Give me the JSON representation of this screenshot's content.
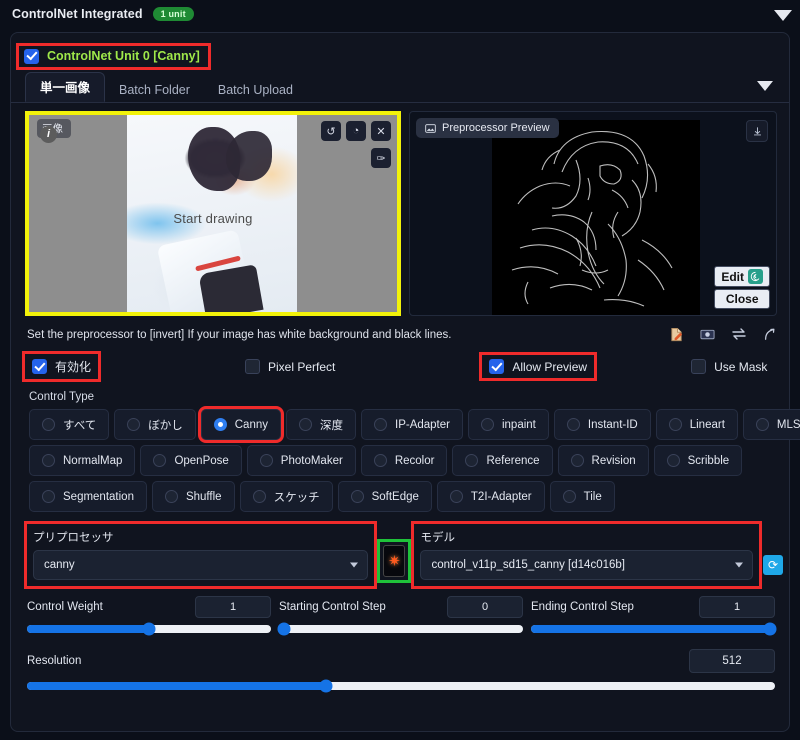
{
  "header": {
    "title": "ControlNet Integrated",
    "badge": "1 unit",
    "collapse_icon": "caret-down-icon"
  },
  "unit": {
    "enabled_checkbox": "checkbox-checked-icon",
    "label": "ControlNet Unit 0  [Canny]",
    "collapse_icon": "caret-down-icon"
  },
  "tabs": [
    {
      "label": "単一画像",
      "active": true
    },
    {
      "label": "Batch Folder",
      "active": false
    },
    {
      "label": "Batch Upload",
      "active": false
    }
  ],
  "canvas": {
    "tag_label": "画像",
    "info_icon": "info-circle-icon",
    "placeholder": "Start drawing",
    "tools": [
      {
        "name": "undo-icon",
        "glyph": "↺"
      },
      {
        "name": "eraser-icon",
        "glyph": "◔"
      },
      {
        "name": "close-icon",
        "glyph": "✕"
      },
      {
        "name": "brush-icon",
        "glyph": "✑"
      }
    ]
  },
  "preview": {
    "tag_label": "Preprocessor Preview",
    "tag_icon": "image-icon",
    "download_icon": "download-icon",
    "edit_label": "Edit",
    "edit_icon": "gimp-icon",
    "close_label": "Close"
  },
  "hint": {
    "text": "Set the preprocessor to [invert] If your image has white background and black lines.",
    "icons": [
      {
        "name": "edit-document-icon",
        "glyph": "📝"
      },
      {
        "name": "photo-icon",
        "glyph": "🖼"
      },
      {
        "name": "swap-icon",
        "glyph": "⇄"
      },
      {
        "name": "curve-arrow-icon",
        "glyph": "⤴"
      }
    ]
  },
  "checkboxes": [
    {
      "label": "有効化",
      "checked": true,
      "highlighted": true
    },
    {
      "label": "Pixel Perfect",
      "checked": false,
      "highlighted": false
    },
    {
      "label": "Allow Preview",
      "checked": true,
      "highlighted": true
    },
    {
      "label": "Use Mask",
      "checked": false,
      "highlighted": false
    }
  ],
  "control_type": {
    "title": "Control Type",
    "selected": "Canny",
    "rows": [
      [
        "すべて",
        "ぼかし",
        "Canny",
        "深度",
        "IP-Adapter",
        "inpaint",
        "Instant-ID",
        "Lineart",
        "MLSD"
      ],
      [
        "NormalMap",
        "OpenPose",
        "PhotoMaker",
        "Recolor",
        "Reference",
        "Revision",
        "Scribble"
      ],
      [
        "Segmentation",
        "Shuffle",
        "スケッチ",
        "SoftEdge",
        "T2I-Adapter",
        "Tile"
      ]
    ]
  },
  "preprocessor": {
    "label": "プリプロセッサ",
    "value": "canny",
    "dropdown_icon": "chevron-down-icon"
  },
  "run_button": {
    "name": "run-preprocessor-button",
    "icon": "spark-icon",
    "glyph": "✷"
  },
  "model": {
    "label": "モデル",
    "value": "control_v11p_sd15_canny [d14c016b]",
    "dropdown_icon": "chevron-down-icon",
    "refresh_icon": "refresh-icon",
    "refresh_glyph": "⟳"
  },
  "sliders": [
    {
      "label": "Control Weight",
      "value": "1",
      "percent": 50
    },
    {
      "label": "Starting Control Step",
      "value": "0",
      "percent": 0
    },
    {
      "label": "Ending Control Step",
      "value": "1",
      "percent": 100
    }
  ],
  "resolution": {
    "label": "Resolution",
    "value": "512",
    "percent": 40
  },
  "colors": {
    "accent_blue": "#1573e6",
    "highlight_red": "#ef2b2b",
    "highlight_green": "#1fc23a",
    "unit_label_green": "#9fe84a",
    "badge_green": "#1f8a34",
    "canvas_border_yellow": "#f2f20a"
  }
}
